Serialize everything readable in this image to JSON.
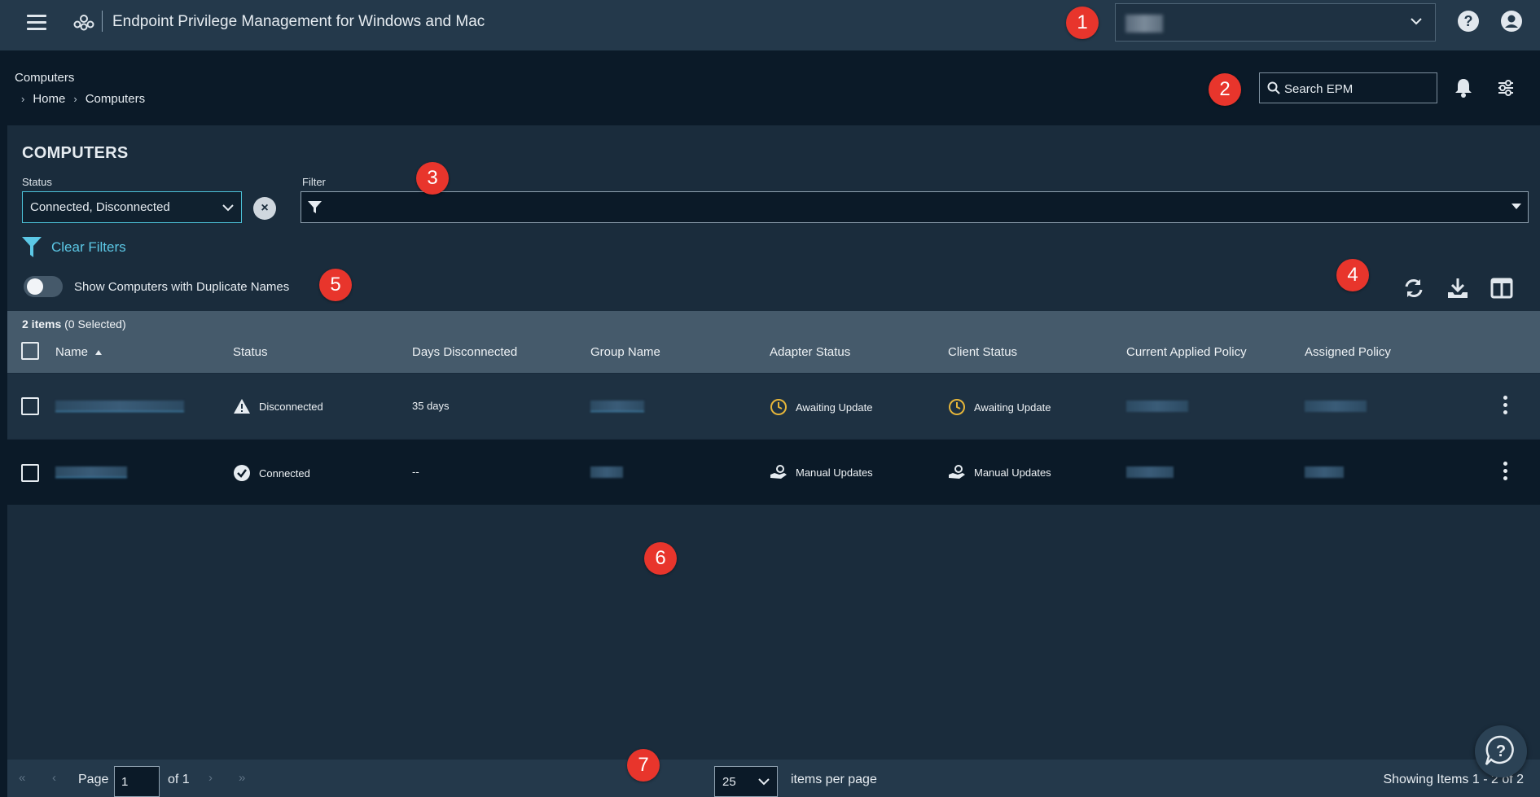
{
  "header": {
    "app_title": "Endpoint Privilege Management for Windows and Mac"
  },
  "badges": [
    "1",
    "2",
    "3",
    "4",
    "5",
    "6",
    "7"
  ],
  "breadcrumb": {
    "title": "Computers",
    "items": [
      "Home",
      "Computers"
    ]
  },
  "search": {
    "placeholder": "Search EPM"
  },
  "page": {
    "title": "COMPUTERS",
    "status_label": "Status",
    "status_value": "Connected, Disconnected",
    "filter_label": "Filter",
    "clear_filters": "Clear Filters",
    "toggle_label": "Show Computers with Duplicate Names"
  },
  "table": {
    "count_bold": "2 items",
    "count_rest": "(0 Selected)",
    "columns": [
      "Name",
      "Status",
      "Days Disconnected",
      "Group Name",
      "Adapter Status",
      "Client Status",
      "Current Applied Policy",
      "Assigned Policy"
    ],
    "rows": [
      {
        "status": "Disconnected",
        "days": "35 days",
        "adapter": "Awaiting Update",
        "client": "Awaiting Update"
      },
      {
        "status": "Connected",
        "days": "--",
        "adapter": "Manual Updates",
        "client": "Manual Updates"
      }
    ]
  },
  "footer": {
    "page_label": "Page",
    "page_value": "1",
    "of_label": "of 1",
    "per_page_value": "25",
    "per_page_label": "items per page",
    "showing": "Showing Items 1 - 2 of 2"
  },
  "colors": {
    "accent": "#5cc8e6",
    "badge": "#e8352c",
    "warning": "#e5b53a"
  }
}
